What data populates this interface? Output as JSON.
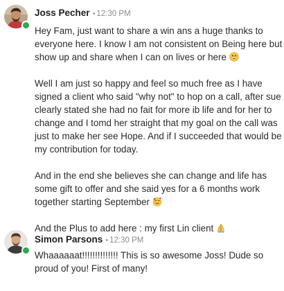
{
  "posts": [
    {
      "author": "Joss Pecher",
      "separator": "•",
      "time": "12:30 PM",
      "online": true,
      "avatar_icon": "avatar-photo-icon",
      "paragraphs": [
        {
          "text": "Hey Fam, just want to share a win ans a huge thanks to everyone here. I know I am not consistent on Being here but show up and share when I can on lives or here ",
          "emoji": "grinning-face-emoji"
        },
        {
          "text": "Well I am just so happy and feel so much free as I have signed a client who said \"why not\" to hop on a call, after sue clearly stated she had no fait for more ib life and for her to change and I tomd her straight that my goal on the call was just to make her see Hope. And if I succeeded that would be my contribution for today.",
          "emoji": ""
        },
        {
          "text": "And in the end she believes she can change and life has some gift to offer and she said yes for a 6 months work together starting September ",
          "emoji": "smiling-face-with-hearts-emoji"
        },
        {
          "text": "And the Plus to add here : my first Lin client ",
          "emoji": "folded-hands-emoji"
        }
      ]
    },
    {
      "author": "Simon Parsons",
      "separator": "•",
      "time": "12:30 PM",
      "online": true,
      "avatar_icon": "avatar-photo-icon",
      "paragraphs": [
        {
          "text": "Whaaaaaat!!!!!!!!!!!!!! This is so awesome Joss! Dude so proud of you! First of many!",
          "emoji": ""
        }
      ]
    }
  ],
  "colors": {
    "online": "#2ea84f",
    "author": "#1f1f1f",
    "time": "#8c8c8c",
    "body_text": "#2b2b2b"
  }
}
